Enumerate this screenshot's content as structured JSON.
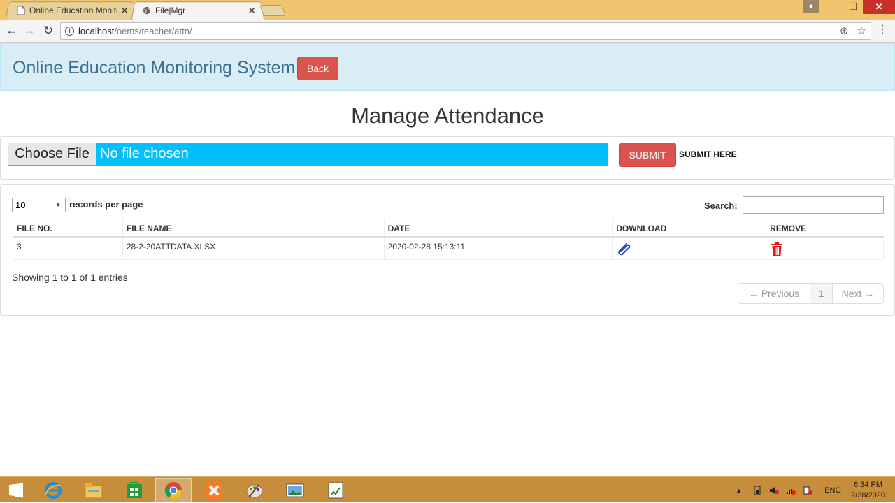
{
  "browser": {
    "tabs": [
      {
        "title": "Online Education Monito",
        "active": false
      },
      {
        "title": "File|Mgr",
        "active": true
      }
    ],
    "url_host": "localhost",
    "url_path": "/oems/teacher/attn/"
  },
  "header": {
    "brand": "Online Education Monitoring System",
    "back_label": "Back"
  },
  "page_title": "Manage Attendance",
  "upload": {
    "choose_label": "Choose File",
    "file_status": "No file chosen",
    "submit_label": "SUBMIT",
    "submit_hint": "SUBMIT HERE"
  },
  "table": {
    "length_value": "10",
    "length_label": "records per page",
    "search_label": "Search:",
    "columns": [
      "FILE NO.",
      "FILE NAME",
      "DATE",
      "DOWNLOAD",
      "REMOVE"
    ],
    "rows": [
      {
        "file_no": "3",
        "file_name": "28-2-20ATTDATA.XLSX",
        "date": "2020-02-28 15:13:11",
        "download_icon": "paperclip-icon",
        "remove_icon": "trash-icon"
      }
    ],
    "info": "Showing 1 to 1 of 1 entries",
    "pagination": {
      "prev": "← Previous",
      "page": "1",
      "next": "Next →"
    }
  },
  "taskbar": {
    "lang": "ENG",
    "time": "6:34 PM",
    "date": "2/28/2020",
    "apps": [
      "windows-start",
      "internet-explorer",
      "file-explorer",
      "store",
      "chrome",
      "xampp",
      "paint",
      "photos",
      "spreadsheet"
    ]
  },
  "colors": {
    "header_bg": "#d9edf7",
    "danger": "#d9534f",
    "file_input_bg": "#00bfff",
    "brand_text": "#3a6f8f",
    "taskbar": "#c58d3c",
    "titlebar": "#f2c46d"
  }
}
